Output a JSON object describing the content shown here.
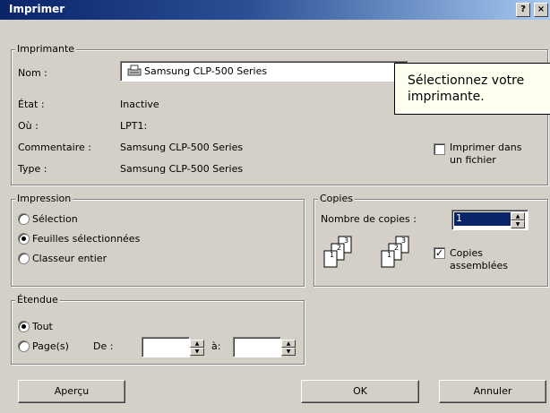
{
  "dialog": {
    "title": "Imprimer",
    "help_button": "?",
    "close_button": "×"
  },
  "printer": {
    "legend": "Imprimante",
    "name_label": "Nom :",
    "name_value": "Samsung CLP-500 Series",
    "state_label": "État :",
    "state_value": "Inactive",
    "where_label": "Où :",
    "where_value": "LPT1:",
    "comment_label": "Commentaire :",
    "comment_value": "Samsung CLP-500 Series",
    "type_label": "Type :",
    "type_value": "Samsung CLP-500 Series",
    "print_to_file_line1": "Imprimer dans",
    "print_to_file_line2": "un fichier",
    "print_to_file_checked": false
  },
  "tooltip": {
    "line1": "Sélectionnez votre",
    "line2": "imprimante."
  },
  "impression": {
    "legend": "Impression",
    "options": [
      "Sélection",
      "Feuilles sélectionnées",
      "Classeur entier"
    ],
    "selected": "Feuilles sélectionnées"
  },
  "copies": {
    "legend": "Copies",
    "count_label": "Nombre de copies :",
    "count_value": "1",
    "collate_line1": "Copies",
    "collate_line2": "assemblées",
    "collate_checked": true,
    "page_labels_a": [
      "1",
      "2",
      "3"
    ],
    "page_labels_b": [
      "1",
      "2",
      "3"
    ]
  },
  "range": {
    "legend": "Étendue",
    "all_label": "Tout",
    "pages_label": "Page(s)",
    "from_label": "De :",
    "to_label": "à:",
    "from_value": "",
    "to_value": "",
    "selected": "Tout"
  },
  "footer": {
    "preview_label": "Aperçu",
    "ok_label": "OK",
    "cancel_label": "Annuler"
  }
}
